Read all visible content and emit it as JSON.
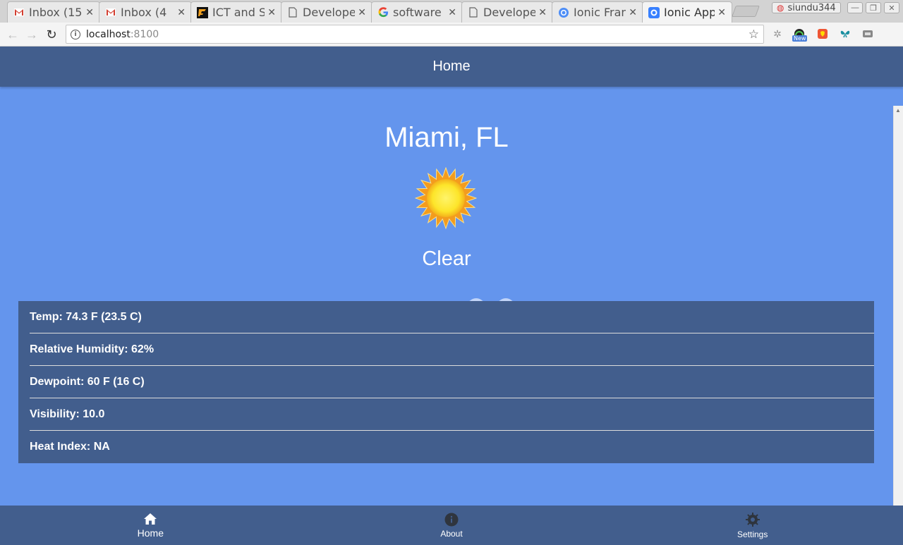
{
  "browser": {
    "tabs": [
      {
        "title": "Inbox (15",
        "icon": "gmail-icon",
        "active": false
      },
      {
        "title": "Inbox (4",
        "icon": "gmail-icon",
        "active": false
      },
      {
        "title": "ICT and S",
        "icon": "ict-icon",
        "active": false
      },
      {
        "title": "Develope",
        "icon": "document-icon",
        "active": false
      },
      {
        "title": "software",
        "icon": "google-icon",
        "active": false
      },
      {
        "title": "Develope",
        "icon": "document-icon",
        "active": false
      },
      {
        "title": "Ionic Fran",
        "icon": "ionic-icon",
        "active": false
      },
      {
        "title": "Ionic App",
        "icon": "ionic-icon",
        "active": true
      }
    ],
    "profile_name": "siundu344",
    "url_host": "localhost",
    "url_port": ":8100",
    "extension_badge": "New"
  },
  "header": {
    "title": "Home"
  },
  "weather": {
    "location": "Miami, FL",
    "condition": "Clear",
    "icon": "sun-icon",
    "details": [
      "Temp: 74.3 F (23.5 C)",
      "Relative Humidity: 62%",
      "Dewpoint: 60 F (16 C)",
      "Visibility: 10.0",
      "Heat Index: NA"
    ]
  },
  "tabbar": {
    "items": [
      {
        "label": "Home",
        "icon": "home-icon"
      },
      {
        "label": "About",
        "icon": "info-icon"
      },
      {
        "label": "Settings",
        "icon": "gear-icon"
      }
    ]
  },
  "colors": {
    "background": "#6495ed",
    "bar": "#425e8d",
    "text": "#ffffff"
  }
}
